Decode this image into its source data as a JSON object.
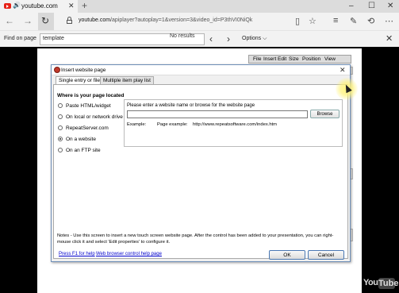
{
  "browser": {
    "tab_title": "youtube.com",
    "new_tab_glyph": "+",
    "address_prefix": "youtube.com",
    "address_rest": "/apiplayer?autoplay=1&version=3&video_id=P3thVI0NiQk",
    "window_controls": [
      "–",
      "☐",
      "✕"
    ]
  },
  "find_bar": {
    "label": "Find on page",
    "query": "template",
    "results": "No results",
    "options_label": "Options ⌵",
    "close_glyph": "✕"
  },
  "app_menu": [
    "File",
    "Insert",
    "Edit",
    "Size",
    "Position",
    "View"
  ],
  "dialog": {
    "title": "Insert website page",
    "close_glyph": "✕",
    "tabs": [
      "Single entry or file",
      "Multiple item play list"
    ],
    "section_heading": "Where is your page located",
    "options": [
      {
        "label": "Paste HTML/widget",
        "selected": false
      },
      {
        "label": "On local or network drive",
        "selected": false
      },
      {
        "label": "RepeatServer.com",
        "selected": false
      },
      {
        "label": "On a website",
        "selected": true
      },
      {
        "label": "On an FTP site",
        "selected": false
      }
    ],
    "prompt": "Please enter a website name or browse for the website page",
    "url_value": "",
    "browse_label": "Browse",
    "example_label": "Example:",
    "page_example_label": "Page example:",
    "example_url": "http://www.repeatsoftware.com/index.htm",
    "notes": "Notes - Use this screen to insert a new touch screen website page.  After the control has been added to your presentation, you can right-mouse click it and select 'Edit properties' to configure it.",
    "help_link": "Press F1 for help",
    "browser_help_link": "Web browser control help page",
    "ok_label": "OK",
    "cancel_label": "Cancel"
  },
  "watermark": {
    "you": "You",
    "tube": "Tube"
  },
  "colors": {
    "youtube_red": "#e62117",
    "dialog_border": "#6f8fb8",
    "link": "#0000cc"
  }
}
